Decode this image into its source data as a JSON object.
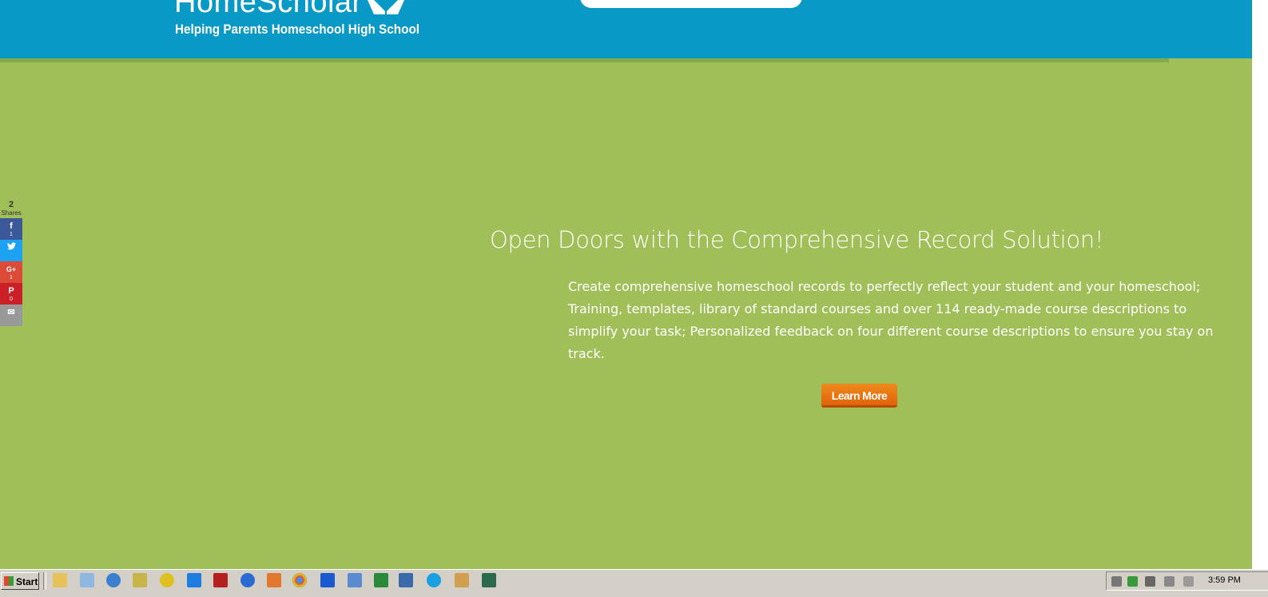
{
  "header": {
    "logo_text": "HomeScholar",
    "tagline": "Helping Parents Homeschool High School"
  },
  "share": {
    "count": "2",
    "label": "Shares",
    "buttons": [
      {
        "name": "facebook",
        "icon": "f",
        "count": "1",
        "color": "#3b5998"
      },
      {
        "name": "twitter",
        "icon": "🐦",
        "count": "",
        "color": "#1da1f2"
      },
      {
        "name": "google-plus",
        "icon": "G+",
        "count": "1",
        "color": "#dc4a38"
      },
      {
        "name": "pinterest",
        "icon": "P",
        "count": "0",
        "color": "#cb2027"
      },
      {
        "name": "email",
        "icon": "✉",
        "count": "",
        "color": "#999999"
      }
    ]
  },
  "hero": {
    "title": "Open Doors with the Comprehensive Record Solution!",
    "text": "Create comprehensive homeschool records to perfectly reflect your student and your homeschool; Training, templates, library of standard courses and over 114 ready-made course descriptions to simplify your task; Personalized feedback on four different course descriptions to ensure you stay on track.",
    "cta_label": "Learn More",
    "background_color": "#a0bf58",
    "cta_color": "#e8700f"
  },
  "taskbar": {
    "start_label": "Start",
    "clock": "3:59 PM",
    "icons": [
      "folder-icon",
      "notepad-icon",
      "gimp-icon",
      "notes-icon",
      "speedtest-icon",
      "dropbox-icon",
      "filezilla-icon",
      "browser-icon",
      "grid-app-icon",
      "chrome-icon",
      "maxthon-icon",
      "keyboard-icon",
      "c-app-icon",
      "window-icon",
      "skype-icon",
      "paint-icon",
      "monitor-icon"
    ]
  }
}
